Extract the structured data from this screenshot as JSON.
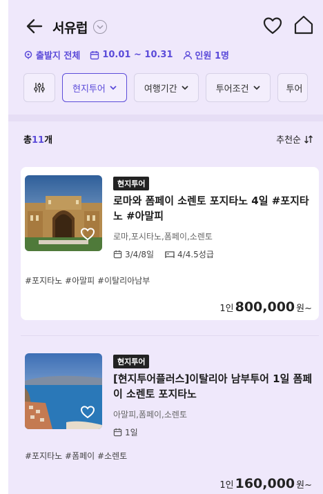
{
  "header": {
    "title": "서유럽"
  },
  "info": {
    "departure": "출발지 전체",
    "dates": "10.01 ~ 10.31",
    "people": "인원 1명"
  },
  "filters": {
    "chips": [
      "현지투어",
      "여행기간",
      "투어조건",
      "투어"
    ]
  },
  "list": {
    "count_prefix": "총",
    "count": "11",
    "count_suffix": "개",
    "sort_label": "추천순"
  },
  "products": [
    {
      "badge": "현지투어",
      "title": "로마와 폼페이 소렌토 포지타노 4일 #포지타노 #아말피",
      "regions": "로마,포시타노,폼페이,소렌토",
      "duration": "3/4/8일",
      "rating": "4/4.5성급",
      "tags": "#포지타노 #아말피 #이탈리아남부",
      "price_prefix": "1인",
      "price": "800,000",
      "price_suffix": "원~"
    },
    {
      "badge": "현지투어",
      "title": "[현지투어플러스]이탈리아 남부투어 1일 폼페이 소렌토 포지타노",
      "regions": "아말피,폼페이,소렌토",
      "duration": "1일",
      "tags": "#포지타노 #폼페이 #소렌토",
      "price_prefix": "1인",
      "price": "160,000",
      "price_suffix": "원~"
    }
  ],
  "colors": {
    "accent": "#5b4bd9",
    "background": "#efe8fb"
  }
}
